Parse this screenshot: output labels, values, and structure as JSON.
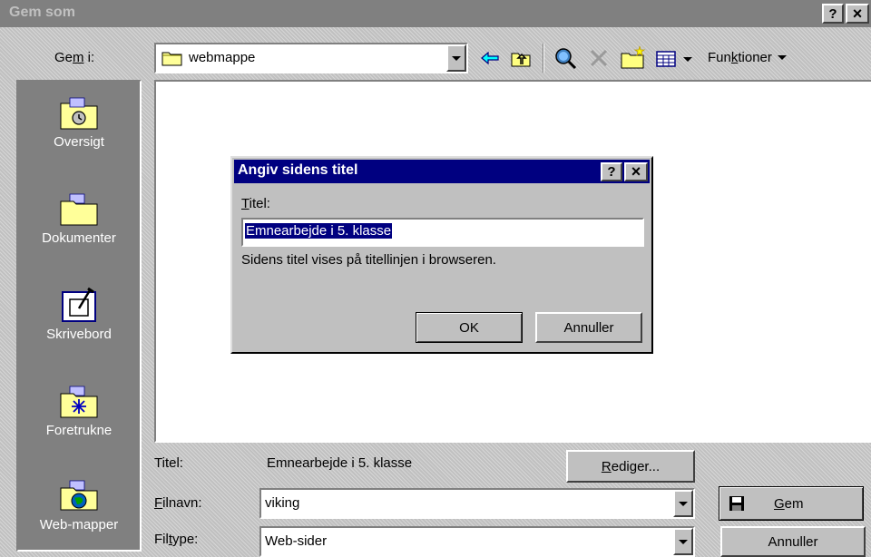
{
  "window": {
    "title": "Gem som",
    "help_icon": "?",
    "close_icon": "×"
  },
  "toolbar": {
    "savein_label_pre": "Ge",
    "savein_label_u": "m",
    "savein_label_post": " i:",
    "location_value": "webmappe",
    "functions_label_pre": "Fun",
    "functions_label_u": "k",
    "functions_label_post": "tioner"
  },
  "places": [
    {
      "label": "Oversigt",
      "icon": "history-folder-icon"
    },
    {
      "label": "Dokumenter",
      "icon": "documents-folder-icon"
    },
    {
      "label": "Skrivebord",
      "icon": "desktop-icon"
    },
    {
      "label": "Foretrukne",
      "icon": "favorites-folder-icon"
    },
    {
      "label": "Web-mapper",
      "icon": "web-folders-icon"
    }
  ],
  "dialog": {
    "title": "Angiv sidens titel",
    "field_label_u": "T",
    "field_label_rest": "itel:",
    "field_value": "Emnearbejde i 5. klasse",
    "hint": "Sidens titel vises på titellinjen i browseren.",
    "ok_label": "OK",
    "cancel_label": "Annuller"
  },
  "bottom": {
    "title_label": "Titel:",
    "title_value": "Emnearbejde i 5. klasse",
    "edit_button_u": "R",
    "edit_button_rest": "ediger...",
    "filename_label_u": "F",
    "filename_label_rest": "ilnavn:",
    "filename_value": "viking",
    "filetype_label_pre": "Fil",
    "filetype_label_u": "t",
    "filetype_label_post": "ype:",
    "filetype_value": "Web-sider",
    "save_button_u": "G",
    "save_button_rest": "em",
    "cancel_button": "Annuller"
  },
  "colors": {
    "inactive_titlebar": "#808080",
    "active_titlebar": "#000080",
    "selection": "#000080",
    "places_bar": "#808080"
  }
}
